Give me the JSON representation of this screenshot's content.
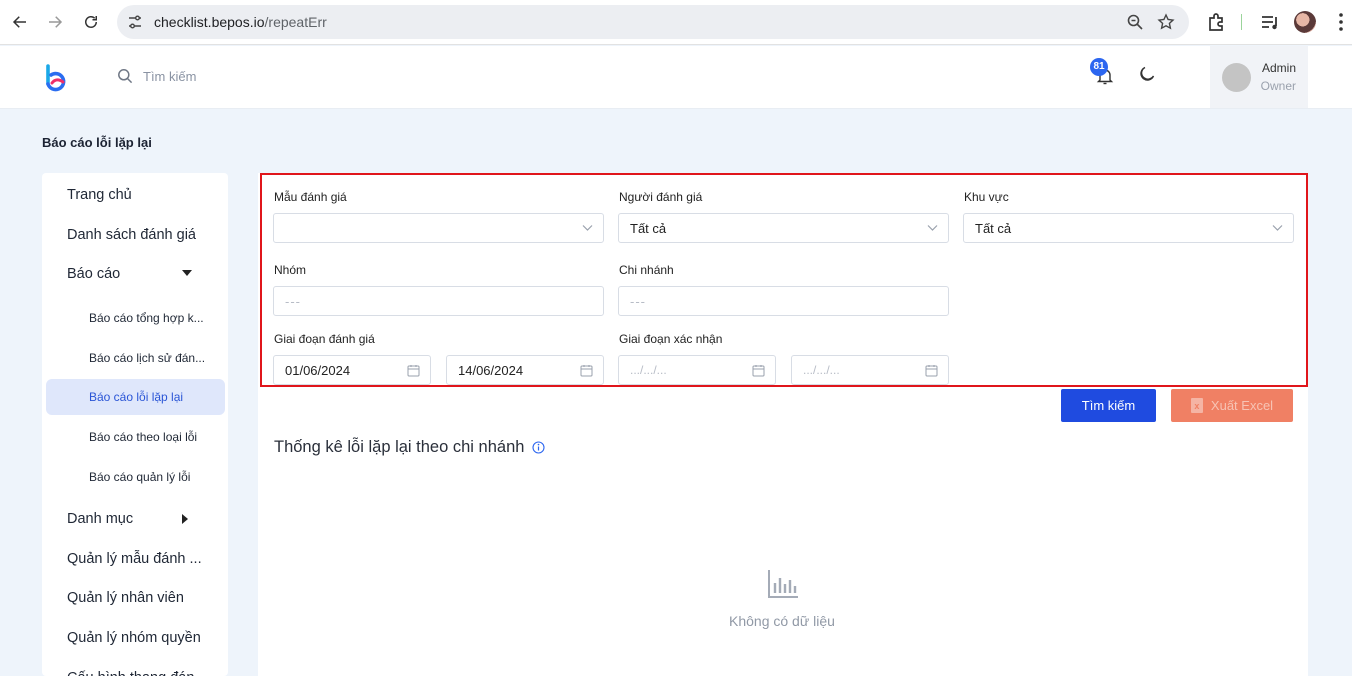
{
  "browser": {
    "url_host": "checklist.bepos.io",
    "url_path": "/repeatErr"
  },
  "header": {
    "search_placeholder": "Tìm kiếm",
    "notification_count": "81",
    "user_name": "Admin",
    "user_role": "Owner"
  },
  "page": {
    "title": "Báo cáo lỗi lặp lại"
  },
  "sidebar": {
    "items": [
      {
        "label": "Trang chủ"
      },
      {
        "label": "Danh sách đánh giá"
      },
      {
        "label": "Báo cáo"
      },
      {
        "label": "Báo cáo tổng hợp k..."
      },
      {
        "label": "Báo cáo lịch sử đán..."
      },
      {
        "label": "Báo cáo lỗi lặp lại"
      },
      {
        "label": "Báo cáo theo loại lỗi"
      },
      {
        "label": "Báo cáo quản lý lỗi"
      },
      {
        "label": "Danh mục"
      },
      {
        "label": "Quản lý mẫu đánh ..."
      },
      {
        "label": "Quản lý nhân viên"
      },
      {
        "label": "Quản lý nhóm quyền"
      },
      {
        "label": "Cấu hình thang đán..."
      }
    ]
  },
  "filters": {
    "template_label": "Mẫu đánh giá",
    "template_value": "",
    "evaluator_label": "Người đánh giá",
    "evaluator_value": "Tất cả",
    "region_label": "Khu vực",
    "region_value": "Tất cả",
    "group_label": "Nhóm",
    "group_placeholder": "---",
    "branch_label": "Chi nhánh",
    "branch_placeholder": "---",
    "eval_period_label": "Giai đoạn đánh giá",
    "eval_from": "01/06/2024",
    "eval_to": "14/06/2024",
    "confirm_period_label": "Giai đoạn xác nhận",
    "confirm_from_placeholder": ".../.../...",
    "confirm_to_placeholder": ".../.../..."
  },
  "actions": {
    "search_label": "Tìm kiếm",
    "export_label": "Xuất Excel"
  },
  "stats": {
    "title": "Thống kê lỗi lặp lại theo chi nhánh",
    "empty_text": "Không có dữ liệu"
  },
  "colors": {
    "primary": "#1f4be0",
    "excel": "#f08064",
    "highlight_border": "#e0151b",
    "active_menu_bg": "#dfe7fb"
  }
}
